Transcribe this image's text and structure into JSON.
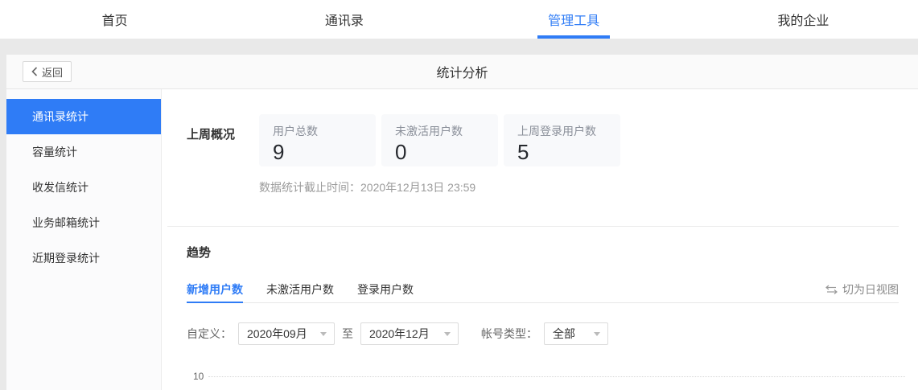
{
  "colors": {
    "accent": "#2f7cf6",
    "page_bg": "#e9e9e9",
    "card_bg": "#f8f9fb"
  },
  "nav": {
    "items": [
      {
        "label": "首页",
        "active": false
      },
      {
        "label": "通讯录",
        "active": false
      },
      {
        "label": "管理工具",
        "active": true
      },
      {
        "label": "我的企业",
        "active": false
      }
    ]
  },
  "header": {
    "back_label": "返回",
    "back_icon": "chevron-left-icon",
    "title": "统计分析"
  },
  "sidebar": {
    "items": [
      {
        "label": "通讯录统计",
        "active": true
      },
      {
        "label": "容量统计",
        "active": false
      },
      {
        "label": "收发信统计",
        "active": false
      },
      {
        "label": "业务邮箱统计",
        "active": false
      },
      {
        "label": "近期登录统计",
        "active": false
      }
    ]
  },
  "overview": {
    "section_title": "上周概况",
    "cards": [
      {
        "label": "用户总数",
        "value": "9"
      },
      {
        "label": "未激活用户数",
        "value": "0"
      },
      {
        "label": "上周登录用户数",
        "value": "5"
      }
    ],
    "note": "数据统计截止时间：2020年12月13日 23:59"
  },
  "trend": {
    "section_title": "趋势",
    "tabs": [
      {
        "label": "新增用户数",
        "active": true
      },
      {
        "label": "未激活用户数",
        "active": false
      },
      {
        "label": "登录用户数",
        "active": false
      }
    ],
    "view_toggle": {
      "icon": "swap-arrows-icon",
      "label": "切为日视图"
    },
    "filters": {
      "custom_label": "自定义：",
      "start_month": "2020年09月",
      "to_label": "至",
      "end_month": "2020年12月",
      "account_type_label": "帐号类型：",
      "account_type_value": "全部",
      "select_icon": "caret-down-icon"
    },
    "chart": {
      "type": "line",
      "visible_y_tick": "10",
      "x_range_start": "2020年09月",
      "x_range_end": "2020年12月"
    }
  }
}
